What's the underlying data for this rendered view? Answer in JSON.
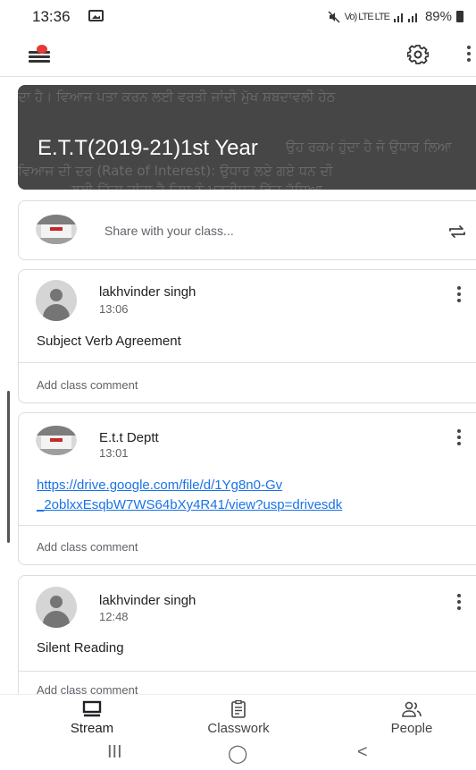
{
  "status_bar": {
    "time": "13:36",
    "network": "Vo) LTE LTE",
    "battery": "89%"
  },
  "class": {
    "title": "E.T.T(2019-21)1st Year",
    "banner_background_text": [
      "ਦਾ ਹੈ। ਵਿਆਜ ਪਤਾ ਕਰਨ ਲਈ ਵਰਤੀ ਜਾਂਦੀ ਮੁੱਖ ਸ਼ਬਦਾਵਲੀ ਹੇਠ",
      "ਉਹ ਰਕਮ ਹੁੰਦਾ ਹੈ ਜੋ ਉਧਾਰ ਲਿਆ",
      "ਵਿਆਜ ਦੀ ਦਰ (Rate of Interest): ਉਧਾਰ ਲਏ ਗਏ ਧਨ ਦੀ",
      "ਲਈ ਦਿੱਤਾ ਜਾਂਦਾ ਹੈ ਜਿਸ ਨੂੰ ਪ੍ਰਤੀਸ਼ਤ ਵਿੱਚ ਦੱਸਿਆ"
    ]
  },
  "share": {
    "placeholder": "Share with your class..."
  },
  "posts": [
    {
      "author": "lakhvinder singh",
      "time": "13:06",
      "text": "Subject Verb Agreement",
      "comment_placeholder": "Add class comment"
    },
    {
      "author": "E.t.t Deptt",
      "time": "13:01",
      "link": "https://drive.google.com/file/d/1Yg8n0-Gv_2oblxxEsqbW7WS64bXy4R41/view?usp=drivesdk",
      "link_line1": "https://drive.google.com/file/d/1Yg8n0-Gv",
      "link_line2": "_2oblxxEsqbW7WS64bXy4R41/view?usp=drivesdk",
      "comment_placeholder": "Add class comment"
    },
    {
      "author": "lakhvinder singh",
      "time": "12:48",
      "text": "Silent Reading",
      "comment_placeholder": "Add class comment"
    }
  ],
  "bottom_nav": [
    {
      "label": "Stream",
      "icon": "stream-icon",
      "active": true
    },
    {
      "label": "Classwork",
      "icon": "classwork-icon",
      "active": false
    },
    {
      "label": "People",
      "icon": "people-icon",
      "active": false
    }
  ],
  "system_nav": {
    "recents": "III",
    "home": "◯",
    "back": "<"
  },
  "colors": {
    "banner": "#464646",
    "link": "#1a73e8",
    "notification_dot": "#e53935"
  }
}
